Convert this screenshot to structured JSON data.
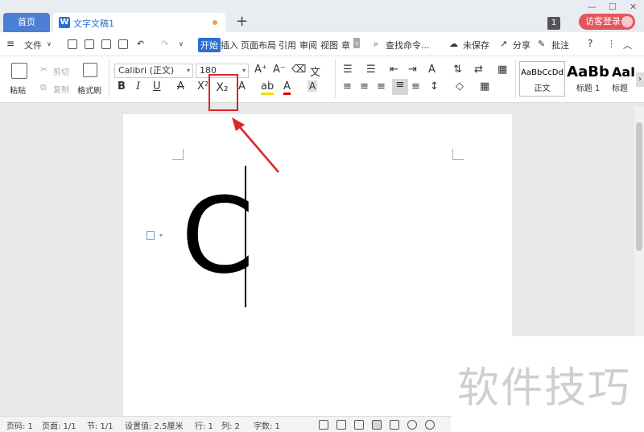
{
  "tabs": {
    "home": "首页",
    "document": "文字文稿1"
  },
  "window": {
    "badge": "1",
    "login": "访客登录"
  },
  "menu": {
    "file": "文件",
    "items": [
      "开始",
      "插入",
      "页面布局",
      "引用",
      "审阅",
      "视图",
      "章"
    ],
    "search": "查找命令...",
    "unsaved": "未保存",
    "share": "分享",
    "comment": "批注",
    "help": "?"
  },
  "ribbon": {
    "paste": "粘贴",
    "cut": "剪切",
    "copy": "复制",
    "format_painter": "格式刷",
    "font_name": "Calibri (正文)",
    "font_size": "180",
    "styles": [
      {
        "preview": "AaBbCcDd",
        "name": "正文"
      },
      {
        "preview": "AaBb",
        "name": "标题 1"
      },
      {
        "preview": "AaI",
        "name": "标题"
      }
    ]
  },
  "document": {
    "content": "C"
  },
  "watermark": "软件技巧",
  "status": {
    "page_num": "页码: 1",
    "page": "页面: 1/1",
    "section": "节: 1/1",
    "setting": "设置值: 2.5厘米",
    "row": "行: 1",
    "col": "列: 2",
    "words": "字数: 1"
  },
  "colors": {
    "accent": "#2b6fd6",
    "login": "#e2565e",
    "highlight": "#d9262c"
  }
}
